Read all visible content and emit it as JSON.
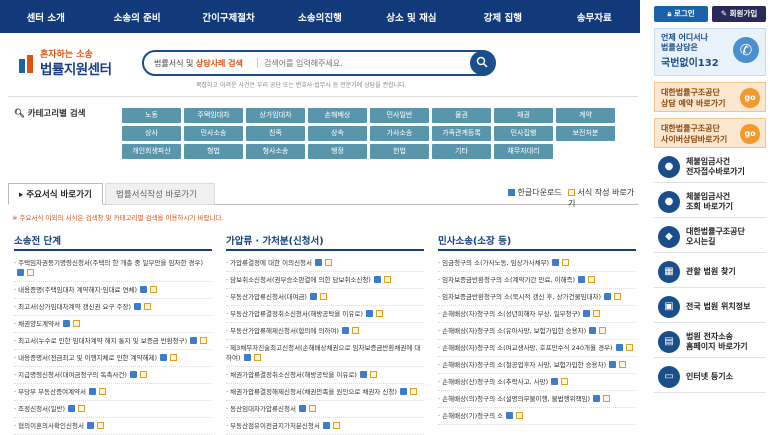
{
  "nav": [
    "센터 소개",
    "소송의 준비",
    "간이구제절차",
    "소송의진행",
    "상소 및 재심",
    "강제 집행",
    "송무자료"
  ],
  "auth": {
    "login": "로그인",
    "join": "회원가입"
  },
  "phone_banner": {
    "line1": "언제 어디서나",
    "line2": "법률상담은",
    "number": "국번없이132"
  },
  "promo": [
    {
      "line1": "대한법률구조공단",
      "line2": "상담 예약 바로가기",
      "go": "go"
    },
    {
      "line1": "대한법률구조공단",
      "line2": "사이버상담바로가기",
      "go": "go"
    }
  ],
  "services": [
    {
      "icon": "person-icon",
      "glyph": "●",
      "line1": "체불임금사건",
      "line2": "전자접수바로가기"
    },
    {
      "icon": "person-icon",
      "glyph": "●",
      "line1": "체불임금사건",
      "line2": "조회 바로가기"
    },
    {
      "icon": "location-icon",
      "glyph": "◆",
      "line1": "대한법률구조공단",
      "line2": "오시는길"
    },
    {
      "icon": "map-icon",
      "glyph": "▦",
      "line1": "관할 법원 찾기",
      "line2": ""
    },
    {
      "icon": "map-icon",
      "glyph": "▣",
      "line1": "전국 법원 위치정보",
      "line2": ""
    },
    {
      "icon": "document-icon",
      "glyph": "▤",
      "line1": "법원 전자소송",
      "line2": "홈페이지 바로가기"
    },
    {
      "icon": "internet-icon",
      "glyph": "▭",
      "line1": "인터넷 등기소",
      "line2": ""
    }
  ],
  "brand": {
    "slogan": "혼자하는 소송",
    "name": "법률지원센터"
  },
  "search": {
    "prefix_a": "법률서식 및 ",
    "prefix_b": "상담사례 검색",
    "placeholder": "검색어를 입력해주세요."
  },
  "notice": "복잡하고 어려운 사건은 우리 공단 또는 변호사·법무사 등 전문가에 상담을 권합니다.",
  "category": {
    "title": "카테고리별 검색",
    "tags": [
      "노동",
      "주택임대차",
      "상가임대차",
      "손해배상",
      "민사일반",
      "물권",
      "채권",
      "계약",
      "상사",
      "민사소송",
      "친족",
      "상속",
      "가사소송",
      "가족관계등록",
      "민사집행",
      "보전처분",
      "개인회생파산",
      "형법",
      "형사소송",
      "행정",
      "헌법",
      "기타",
      "채무자대리"
    ]
  },
  "tabs": {
    "t1": "주요서식 바로가기",
    "t2": "법률서식작성 바로가기",
    "hangul": "한글다운로드",
    "write": "서식 작성 바로가기"
  },
  "hint": "※ 주요서식 이외의 서식은 검색창 및 카테고리별 검색을 이용하시기 바랍니다.",
  "columns": [
    {
      "heading": "소송전 단계",
      "items": [
        "주택임차권등기명령신청서(주택의 한 개층 중 일부만을 임차한 경우)",
        "내용증명(주택임대차 계약해지·임대료 연체)",
        "최고서(상가임대차계약 갱신권 요구 주장)",
        "채권양도계약서",
        "최고서(누수로 인한 임대차계약 해지 통지 및 보증금 반환청구)",
        "내용증명서(전금최고 및 이행지체로 인한 계약해제)",
        "지급명령신청서(대여금청구의 독촉사건)",
        "부당부 부동산증여계약서",
        "조정신청서(일반)",
        "협의이혼의사확인신청서"
      ]
    },
    {
      "heading": "가압류 · 가처분(신청서)",
      "items": [
        "가압류결정에 대한 이의신청서",
        "담보취소신청서(권부승소판결에 의한 담보취소신청)",
        "부동산가압류신청서(대여금)",
        "부동산가압류결정취소신청서(해방공탁을 이유로)",
        "부동산가압류해제신청서(합의에 의하여)",
        "제3채무자진술최고신청서(손해배상채권으로 임차보증금반환채권에 대하여)",
        "채권가압류결정취소신청서(해방공탁을 이유로)",
        "채권가압류결정해제신청서(채권만족을 원인으로 채권자 신청)",
        "동산임대차가압류신청서",
        "부동산점유이전금지가처분신청서"
      ]
    },
    {
      "heading": "민사소송(소장 등)",
      "items": [
        "임금청구의 소(가사노동, 임상가사채무)",
        "임차보증금반환청구의 소(계약기간 만료, 이해즉)",
        "임차보증금반환청구의 소(묵시적 갱신 후, 상가건물임대차)",
        "손해배상(자)청구의 소(성년피해자 부상, 일부청구)",
        "손해배상(자)청구의 소(유아사망, 보험가입한 승용차)",
        "손해배상(자)청구의 소(여교생사망, 호프만수식 240개월 경우)",
        "손해배상(자)청구의 소(철공업후자 사망, 보험가입한 승용차)",
        "손해배상(산)청구의 소(추락사고, 사망)",
        "손해배상(의)청구의 소(설명의무불이행, 불법행위책임)",
        "손해배상(기)청구의 소"
      ]
    }
  ]
}
